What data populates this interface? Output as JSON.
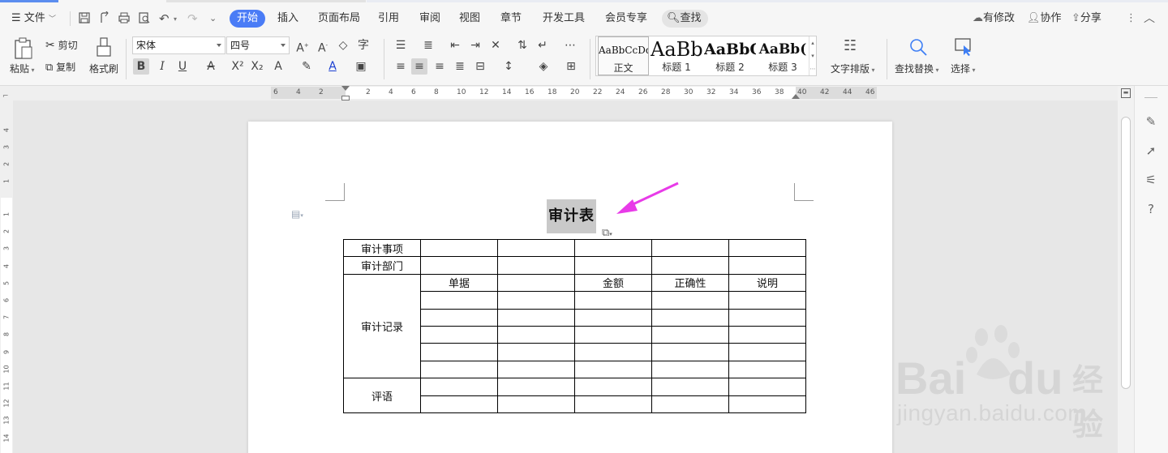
{
  "menubar": {
    "file_label": "文件",
    "tabs": [
      "开始",
      "插入",
      "页面布局",
      "引用",
      "审阅",
      "视图",
      "章节",
      "开发工具",
      "会员专享"
    ],
    "active_tab": "开始",
    "search_label": "查找",
    "right": {
      "modified": "有修改",
      "collab": "协作",
      "share": "分享"
    }
  },
  "ribbon": {
    "clipboard": {
      "paste": "粘贴",
      "cut": "剪切",
      "copy": "复制",
      "format_painter": "格式刷"
    },
    "font": {
      "name": "宋体",
      "size": "四号"
    },
    "styles": [
      {
        "preview": "AaBbCcDd",
        "name": "正文"
      },
      {
        "preview": "AaBb",
        "name": "标题 1"
      },
      {
        "preview": "AaBbC",
        "name": "标题 2"
      },
      {
        "preview": "AaBb(",
        "name": "标题 3"
      }
    ],
    "text_layout": "文字排版",
    "find_replace": "查找替换",
    "select": "选择"
  },
  "ruler": {
    "h_ticks": [
      "6",
      "4",
      "2",
      "2",
      "4",
      "6",
      "8",
      "10",
      "12",
      "14",
      "16",
      "18",
      "20",
      "22",
      "24",
      "26",
      "28",
      "30",
      "32",
      "34",
      "36",
      "38",
      "40",
      "42",
      "44",
      "46"
    ],
    "v_ticks": [
      "4",
      "3",
      "2",
      "1",
      "1",
      "2",
      "3",
      "4",
      "5",
      "6",
      "7",
      "8",
      "9",
      "10",
      "11",
      "12",
      "13",
      "14"
    ]
  },
  "document": {
    "title": "审计表",
    "table": {
      "row_audit_item": "审计事项",
      "row_audit_dept": "审计部门",
      "row_audit_record": "审计记录",
      "row_comment": "评语",
      "col_receipt": "单据",
      "col_amount": "金额",
      "col_correctness": "正确性",
      "col_note": "说明"
    }
  },
  "watermark": {
    "brand": "Bai",
    "suffix": "du",
    "cn": "经验",
    "url": "jingyan.baidu.com"
  },
  "colors": {
    "accent": "#4a7cf6",
    "annotation_arrow": "#e83be8"
  }
}
